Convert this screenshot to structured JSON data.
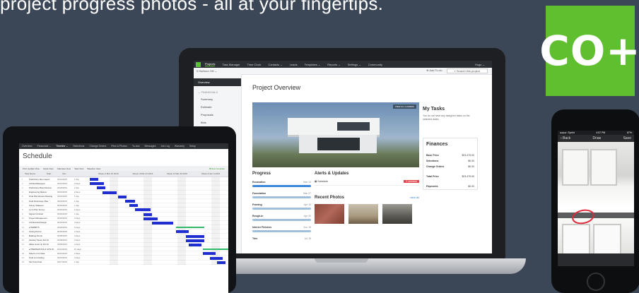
{
  "tagline": "project progress photos - all at your fingertips.",
  "brand": {
    "logo_text": "CO+",
    "accent": "#5fbf2e",
    "background": "#3b4656"
  },
  "laptop": {
    "nav": {
      "items": [
        "Projects",
        "Task Manager",
        "Time Clock",
        "Contacts ⌄",
        "Leads",
        "Templates ⌄",
        "Reports ⌄",
        "Settings ⌄",
        "Community"
      ],
      "user": "Hugo ⌄"
    },
    "subbar": {
      "project": "0 Harbour Hill ⌄",
      "add_todo": "⊕ Add To-do",
      "search_placeholder": "⌕ Search this project"
    },
    "sidebar": {
      "selected": "Overview",
      "group": "⌄ FINANCIALS",
      "items": [
        "Summary",
        "Estimate",
        "Proposals",
        "Bids"
      ]
    },
    "main": {
      "title": "Project Overview",
      "hero_badge": "VIEW ALL CAMERA",
      "progress": {
        "title": "Progress",
        "rows": [
          {
            "label": "Excavation",
            "date": "Mar 13"
          },
          {
            "label": "Foundation",
            "date": "Mar 27"
          },
          {
            "label": "Framing",
            "date": "Apr 10"
          },
          {
            "label": "Rough-in",
            "date": "Apr 20"
          },
          {
            "label": "Interior Finishes",
            "date": "Jun 15"
          },
          {
            "label": "Trim",
            "date": "Jul 15"
          }
        ]
      },
      "alerts": {
        "title": "Alerts & Updates",
        "row_label": "Schedule",
        "row_tag": "1 overdue"
      },
      "photos": {
        "title": "Recent Photos",
        "view_all": "view all"
      },
      "tasks": {
        "title": "My Tasks",
        "message": "You do not have any assigned tasks on the selected dates."
      },
      "finances": {
        "title": "Finances",
        "rows": [
          {
            "label": "Base Price",
            "value": "$23,479.00"
          },
          {
            "label": "Selections",
            "value": "$0.00"
          },
          {
            "label": "Change Orders",
            "value": "$0.00"
          },
          {
            "label": "Total Price",
            "value": "$23,479.00"
          },
          {
            "label": "Payments",
            "value": "$0.00"
          }
        ]
      }
    }
  },
  "tablet": {
    "nav": [
      "Overview",
      "Financials ⌄",
      "Timeline ⌄",
      "Selections",
      "Change Orders",
      "Files & Photos",
      "To-dos",
      "Messages",
      "Job Log",
      "Warranty",
      "Setup"
    ],
    "title": "Schedule",
    "toolbar": [
      "Print Update View",
      "Gantt View",
      "Calendar View",
      "Task View",
      "Baseline View"
    ],
    "toolbar_action": "✚ New Template",
    "gantt_head_left": [
      "Task Name",
      "Start",
      "Dur."
    ],
    "gantt_head_right": [
      "Week of Mar 16 2015",
      "Week of Mar 23 2015",
      "Week of Mar 30 2015",
      "Week of Apr 6 2015"
    ],
    "rows": [
      {
        "n": "1",
        "name": "Preliminary Site Inspect",
        "start": "03/16/2015",
        "dur": "1 day"
      },
      {
        "n": "2",
        "name": "Architect/Designer",
        "start": "03/16/2015",
        "dur": "2 days"
      },
      {
        "n": "3",
        "name": "Preliminary Plans Review",
        "start": "03/18/2015",
        "dur": "1 day"
      },
      {
        "n": "4",
        "name": "Engineering Review",
        "start": "03/19/2015",
        "dur": "2 days"
      },
      {
        "n": "5",
        "name": "Final Plan Review Meeting",
        "start": "03/23/2015",
        "dur": "1 day"
      },
      {
        "n": "6",
        "name": "Final Preliminary Plan",
        "start": "03/24/2015",
        "dur": "1 day"
      },
      {
        "n": "7",
        "name": "Survey Stakeout",
        "start": "03/25/2015",
        "dur": "1 day"
      },
      {
        "n": "8",
        "name": "Lot & Plan Survey",
        "start": "03/26/2015",
        "dur": "2 days"
      },
      {
        "n": "9",
        "name": "Signed Contract",
        "start": "03/30/2015",
        "dur": "1 day"
      },
      {
        "n": "10",
        "name": "Project Management",
        "start": "03/30/2015",
        "dur": "2 days"
      },
      {
        "n": "11",
        "name": "Architectural Design",
        "start": "04/01/2015",
        "dur": "3 days"
      },
      {
        "n": "12",
        "name": "▸ PERMITS",
        "start": "04/06/2015",
        "dur": "5 days"
      },
      {
        "n": "13",
        "name": "Zoning Permit",
        "start": "04/06/2015",
        "dur": "2 days"
      },
      {
        "n": "14",
        "name": "Building Permit",
        "start": "04/08/2015",
        "dur": "3 days"
      },
      {
        "n": "15",
        "name": "Sanitary Sewer Permit",
        "start": "04/08/2015",
        "dur": "3 days"
      },
      {
        "n": "16",
        "name": "Water Hook Up Permit",
        "start": "04/09/2015",
        "dur": "2 days"
      },
      {
        "n": "17",
        "name": "▸ PREPARATION & SITE W...",
        "start": "04/13/2015",
        "dur": "10 days"
      },
      {
        "n": "18",
        "name": "Select Lot & Clear",
        "start": "04/13/2015",
        "dur": "2 days"
      },
      {
        "n": "19",
        "name": "Final Lot Grading",
        "start": "04/15/2015",
        "dur": "2 days"
      },
      {
        "n": "20",
        "name": "Set Temp Pole",
        "start": "04/17/2015",
        "dur": "1 day"
      }
    ]
  },
  "phone": {
    "carrier": "●●●●○ Sprint",
    "time": "4:57 PM",
    "battery": "67%",
    "back": "‹ Back",
    "title": "Draw",
    "action": "Save"
  }
}
